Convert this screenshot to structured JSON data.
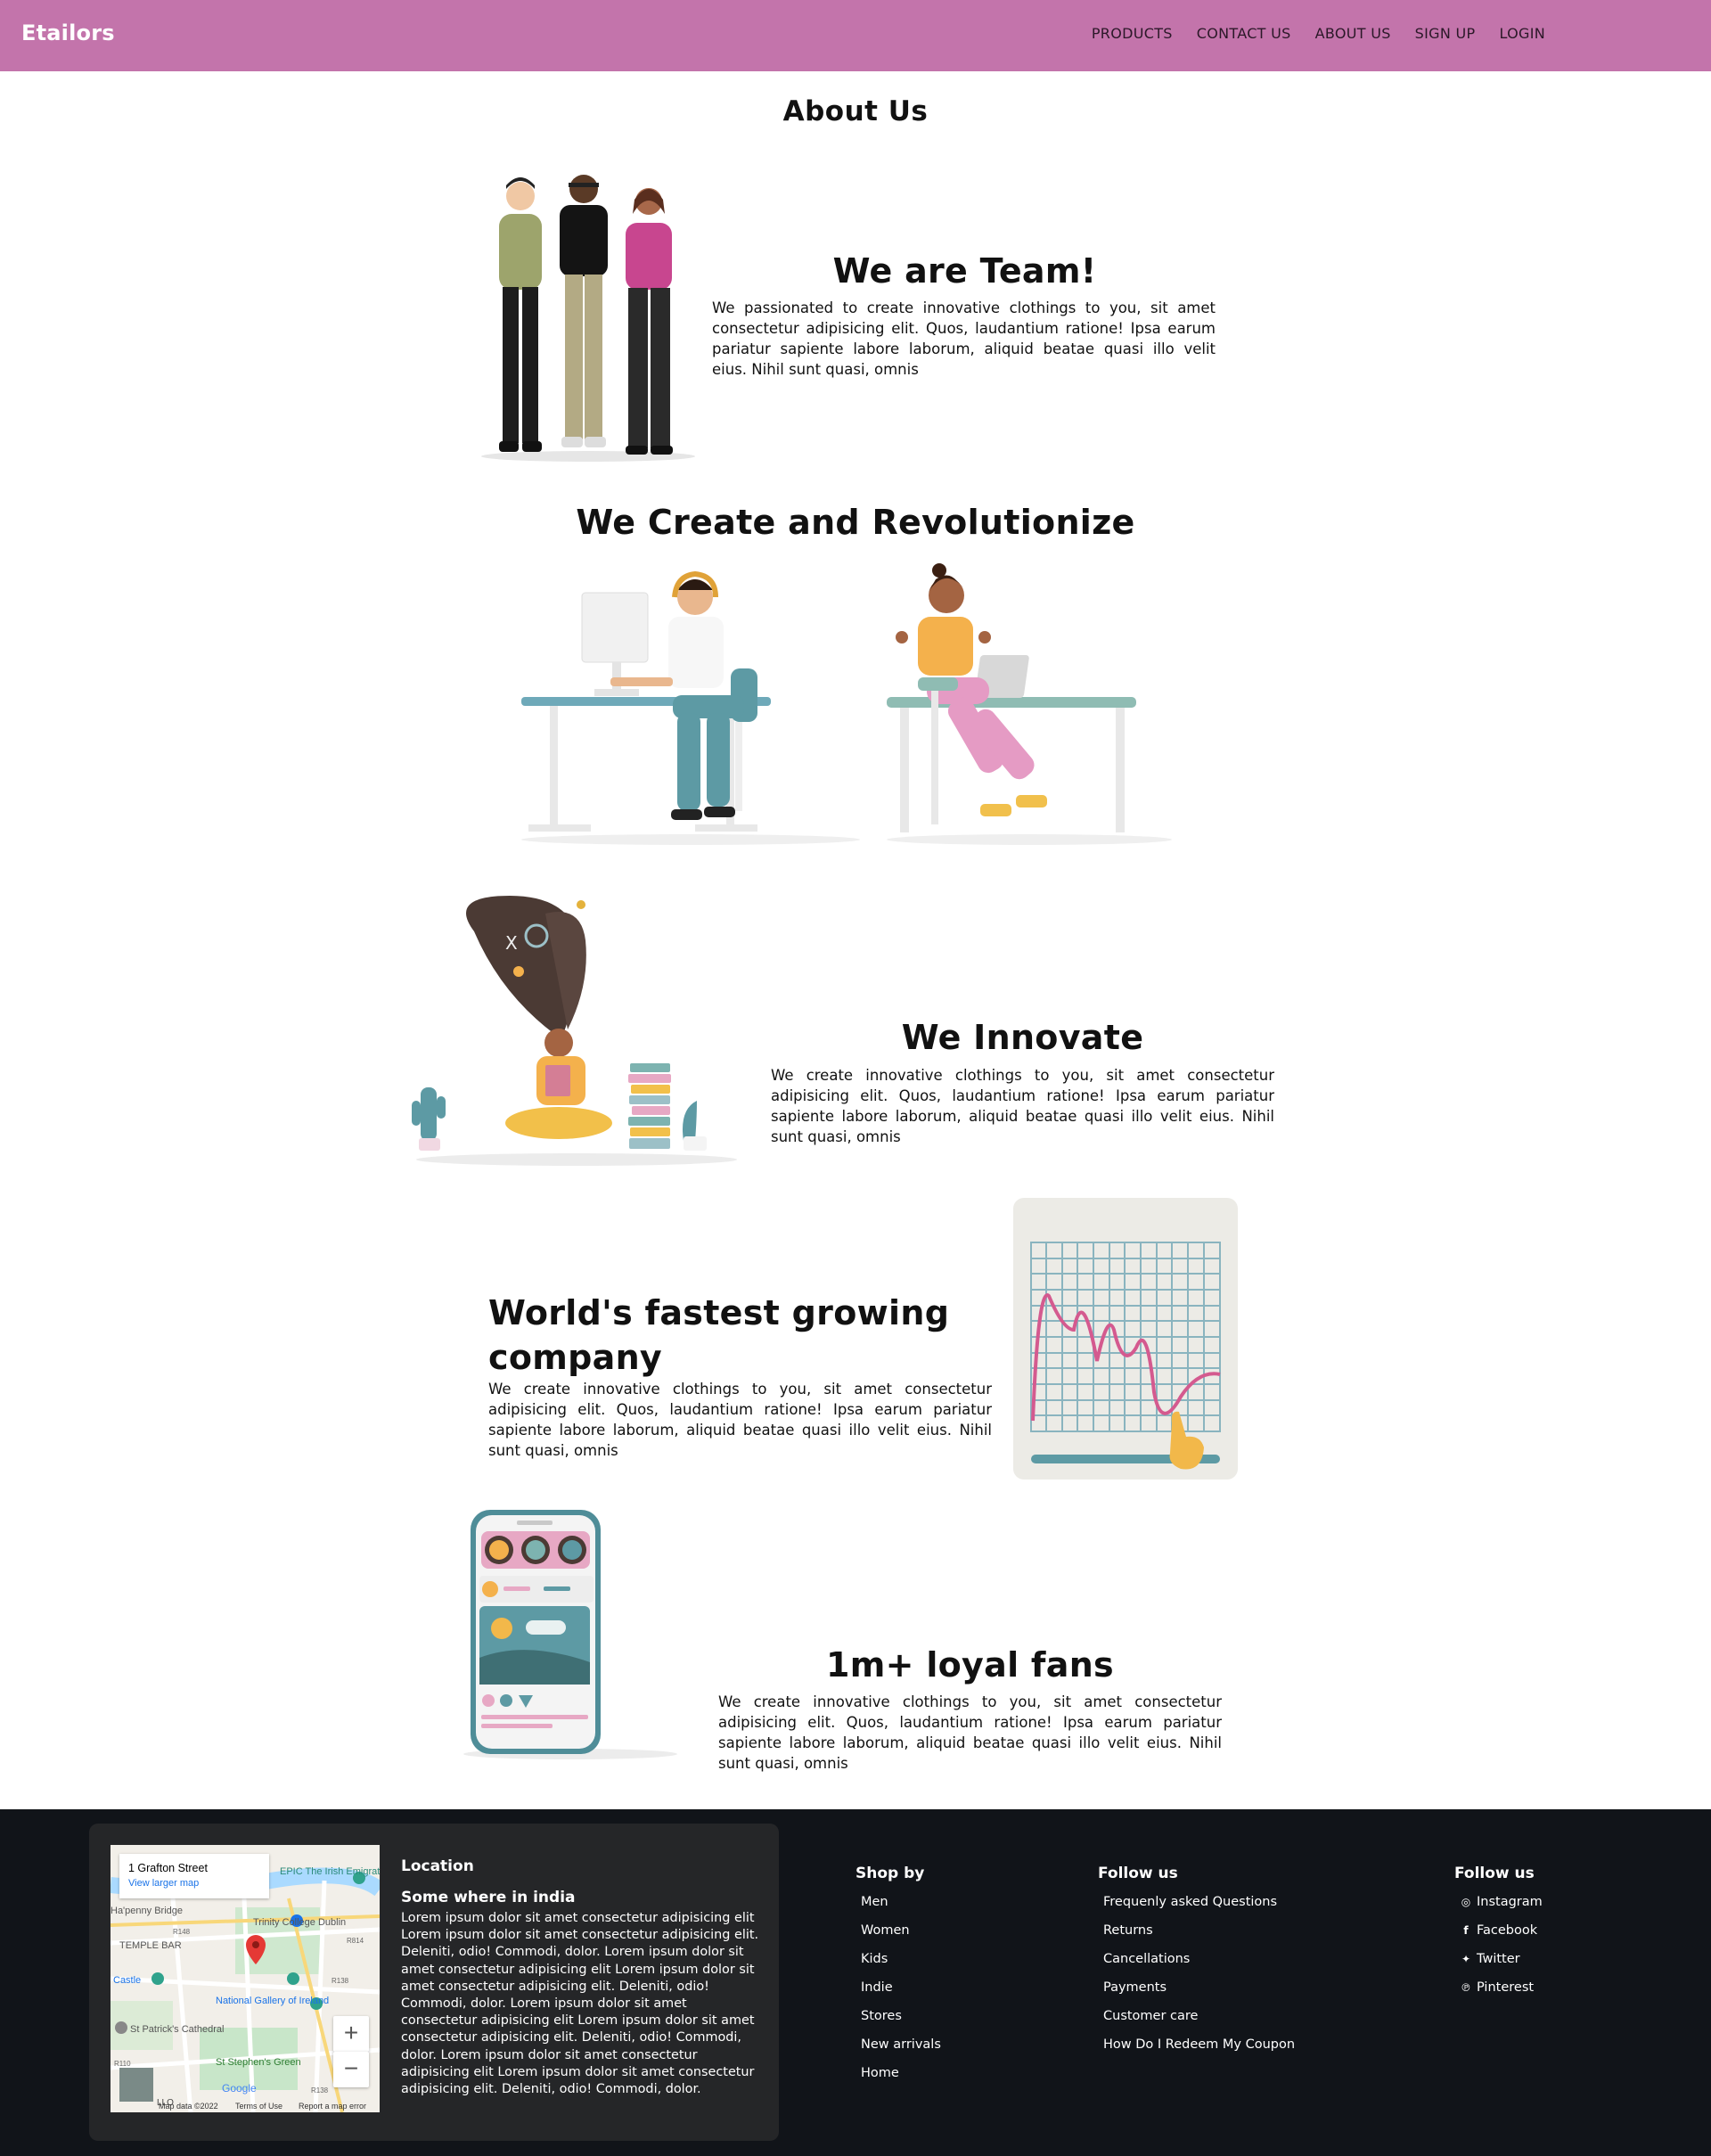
{
  "navbar": {
    "brand": "Etailors",
    "links": [
      "PRODUCTS",
      "CONTACT US",
      "ABOUT US",
      "SIGN UP",
      "LOGIN"
    ],
    "background": "#c374ab"
  },
  "page_title": "About Us",
  "sections": {
    "team": {
      "heading": "We are Team!",
      "text": "We passionated to create innovative clothings to you, sit amet consectetur adipisicing elit. Quos, laudantium ratione! Ipsa earum pariatur sapiente labore laborum, aliquid beatae quasi illo velit eius. Nihil sunt quasi, omnis"
    },
    "create": {
      "heading": "We Create and Revolutionize"
    },
    "innovate": {
      "heading": "We Innovate",
      "text": "We create innovative clothings to you, sit amet consectetur adipisicing elit. Quos, laudantium ratione! Ipsa earum pariatur sapiente labore laborum, aliquid beatae quasi illo velit eius. Nihil sunt quasi, omnis"
    },
    "growing": {
      "heading": "World's fastest growing company",
      "text": "We create innovative clothings to you, sit amet consectetur adipisicing elit. Quos, laudantium ratione! Ipsa earum pariatur sapiente labore laborum, aliquid beatae quasi illo velit eius. Nihil sunt quasi, omnis"
    },
    "fans": {
      "heading": "1m+ loyal fans",
      "text": "We create innovative clothings to you, sit amet consectetur adipisicing elit. Quos, laudantium ratione! Ipsa earum pariatur sapiente labore laborum, aliquid beatae quasi illo velit eius. Nihil sunt quasi, omnis"
    }
  },
  "footer": {
    "background": "#111419",
    "location": {
      "title": "Location",
      "subtitle": "Some where in india",
      "body": "Lorem ipsum dolor sit amet consectetur adipisicing elit Lorem ipsum dolor sit amet consectetur adipisicing elit. Deleniti, odio! Commodi, dolor. Lorem ipsum dolor sit amet consectetur adipisicing elit Lorem ipsum dolor sit amet consectetur adipisicing elit. Deleniti, odio! Commodi, dolor. Lorem ipsum dolor sit amet consectetur adipisicing elit Lorem ipsum dolor sit amet consectetur adipisicing elit. Deleniti, odio! Commodi, dolor. Lorem ipsum dolor sit amet consectetur adipisicing elit Lorem ipsum dolor sit amet consectetur adipisicing elit. Deleniti, odio! Commodi, dolor.",
      "map": {
        "place": "1 Grafton Street",
        "link": "View larger map",
        "labels": {
          "epic": "EPIC The Irish Emigration Museum",
          "bridge": "Ha'penny Bridge",
          "college": "Trinity College Dublin",
          "temple": "TEMPLE BAR",
          "castle": "Castle",
          "gallery": "National Gallery of Ireland",
          "cathedral": "St Patrick's Cathedral",
          "green": "St Stephen's Green",
          "r148": "R148",
          "r814": "R814",
          "r138": "R138",
          "r110": "R110",
          "r138b": "R138",
          "google": "Google",
          "fragment": "LLO",
          "zoom_in": "+",
          "zoom_out": "−"
        },
        "footer": [
          "Map data ©2022",
          "Terms of Use",
          "Report a map error"
        ]
      }
    },
    "shop_by": {
      "title": "Shop by",
      "items": [
        "Men",
        "Women",
        "Kids",
        "Indie",
        "Stores",
        "New arrivals",
        "Home"
      ]
    },
    "follow_links": {
      "title": "Follow us",
      "items": [
        "Frequenly asked Questions",
        "Returns",
        "Cancellations",
        "Payments",
        "Customer care",
        "How Do I Redeem My Coupon"
      ]
    },
    "follow_social": {
      "title": "Follow us",
      "items": [
        {
          "icon": "instagram-icon",
          "label": "Instagram"
        },
        {
          "icon": "facebook-icon",
          "label": "Facebook"
        },
        {
          "icon": "twitter-icon",
          "label": "Twitter"
        },
        {
          "icon": "pinterest-icon",
          "label": "Pinterest"
        }
      ]
    }
  }
}
